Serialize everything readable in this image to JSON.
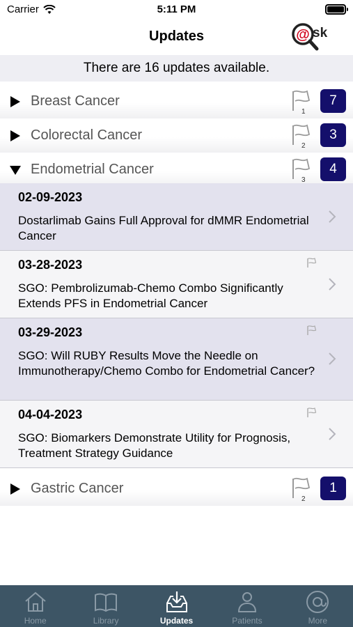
{
  "status_bar": {
    "carrier": "Carrier",
    "time": "5:11 PM"
  },
  "nav": {
    "title": "Updates",
    "logo_text": "@sk"
  },
  "banner": {
    "text": "There are 16 updates available."
  },
  "categories": [
    {
      "label": "Breast Cancer",
      "flag_count": "1",
      "badge": "7",
      "expanded": false
    },
    {
      "label": "Colorectal Cancer",
      "flag_count": "2",
      "badge": "3",
      "expanded": false
    },
    {
      "label": "Endometrial Cancer",
      "flag_count": "3",
      "badge": "4",
      "expanded": true
    },
    {
      "label": "Gastric Cancer",
      "flag_count": "2",
      "badge": "1",
      "expanded": false
    }
  ],
  "updates": [
    {
      "date": "02-09-2023",
      "title": "Dostarlimab Gains Full Approval for dMMR Endometrial Cancer",
      "flagged": false
    },
    {
      "date": "03-28-2023",
      "title": "SGO: Pembrolizumab-Chemo Combo Significantly Extends PFS in Endometrial Cancer",
      "flagged": true
    },
    {
      "date": "03-29-2023",
      "title": "SGO: Will RUBY Results Move the Needle on Immunotherapy/Chemo Combo for Endometrial Cancer?",
      "flagged": true
    },
    {
      "date": "04-04-2023",
      "title": "SGO: Biomarkers Demonstrate Utility for Prognosis, Treatment Strategy Guidance",
      "flagged": true
    }
  ],
  "tabs": [
    {
      "label": "Home",
      "icon": "home-icon",
      "active": false
    },
    {
      "label": "Library",
      "icon": "book-icon",
      "active": false
    },
    {
      "label": "Updates",
      "icon": "inbox-download-icon",
      "active": true
    },
    {
      "label": "Patients",
      "icon": "person-icon",
      "active": false
    },
    {
      "label": "More",
      "icon": "at-sign-icon",
      "active": false
    }
  ],
  "colors": {
    "badge": "#140f6b",
    "tab_bar": "#3d5565",
    "shaded_row": "#e3e2ee",
    "logo_red": "#d0021b"
  }
}
